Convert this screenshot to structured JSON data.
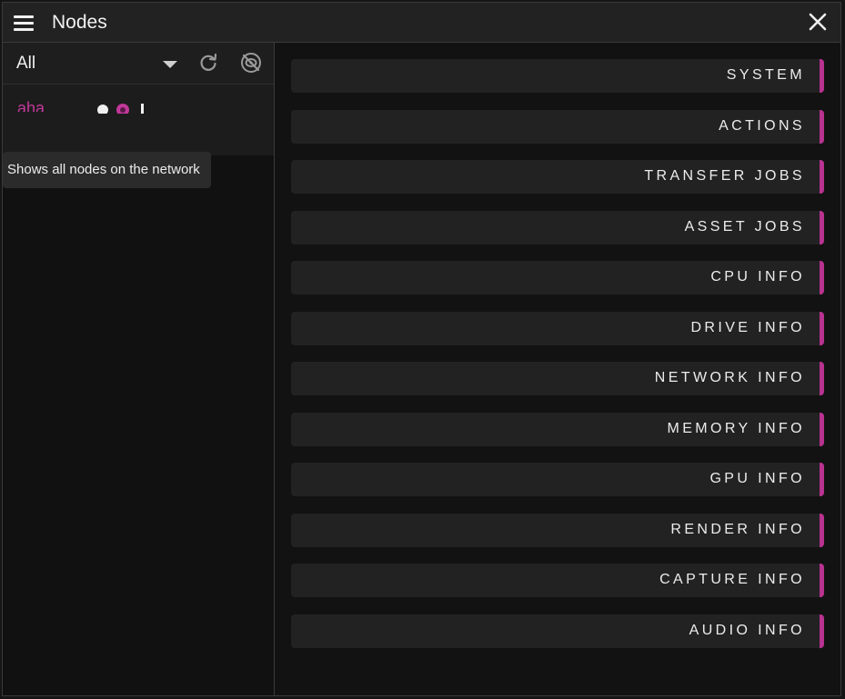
{
  "window": {
    "title": "Nodes"
  },
  "filter": {
    "value": "All"
  },
  "node": {
    "name": "aha"
  },
  "tooltip": {
    "text": "Shows all nodes on the network"
  },
  "accent_color": "#b8328f",
  "sections": [
    {
      "label": "SYSTEM"
    },
    {
      "label": "ACTIONS"
    },
    {
      "label": "TRANSFER JOBS"
    },
    {
      "label": "ASSET JOBS"
    },
    {
      "label": "CPU INFO"
    },
    {
      "label": "DRIVE INFO"
    },
    {
      "label": "NETWORK INFO"
    },
    {
      "label": "MEMORY INFO"
    },
    {
      "label": "GPU INFO"
    },
    {
      "label": "RENDER INFO"
    },
    {
      "label": "CAPTURE INFO"
    },
    {
      "label": "AUDIO INFO"
    }
  ]
}
